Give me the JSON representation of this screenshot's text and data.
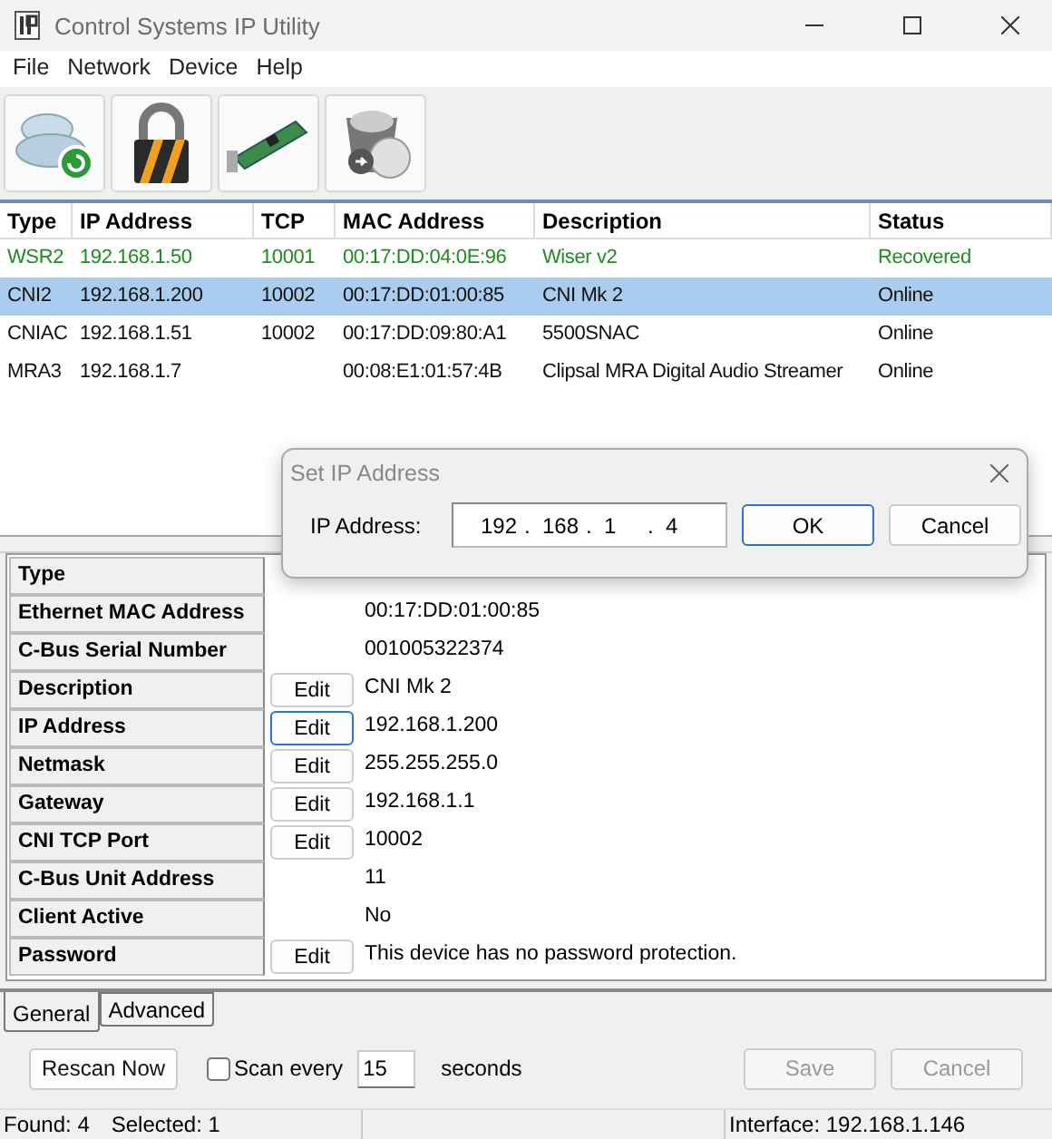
{
  "window": {
    "title": "Control Systems IP Utility"
  },
  "menu": [
    "File",
    "Network",
    "Device",
    "Help"
  ],
  "table": {
    "columns": [
      "Type",
      "IP Address",
      "TCP",
      "MAC Address",
      "Description",
      "Status"
    ],
    "rows": [
      {
        "cells": [
          "WSR2",
          "192.168.1.50",
          "10001",
          "00:17:DD:04:0E:96",
          "Wiser v2",
          "Recovered"
        ],
        "color": "#1e8c1e",
        "selected": false
      },
      {
        "cells": [
          "CNI2",
          "192.168.1.200",
          "10002",
          "00:17:DD:01:00:85",
          "CNI Mk 2",
          "Online"
        ],
        "selected": true
      },
      {
        "cells": [
          "CNIAC",
          "192.168.1.51",
          "10002",
          "00:17:DD:09:80:A1",
          "5500SNAC",
          "Online"
        ],
        "selected": false
      },
      {
        "cells": [
          "MRA3",
          "192.168.1.7",
          "",
          "00:08:E1:01:57:4B",
          "Clipsal MRA Digital Audio Streamer",
          "Online"
        ],
        "selected": false
      }
    ]
  },
  "properties": [
    {
      "label": "Type"
    },
    {
      "label": "Ethernet MAC Address",
      "value": "00:17:DD:01:00:85"
    },
    {
      "label": "C-Bus Serial Number",
      "value": "001005322374"
    },
    {
      "label": "Description",
      "value": "CNI Mk 2",
      "edit": {
        "label": "Edit",
        "focused": false
      }
    },
    {
      "label": "IP Address",
      "value": "192.168.1.200",
      "edit": {
        "label": "Edit",
        "focused": true
      }
    },
    {
      "label": "Netmask",
      "value": "255.255.255.0",
      "edit": {
        "label": "Edit",
        "focused": false
      }
    },
    {
      "label": "Gateway",
      "value": "192.168.1.1",
      "edit": {
        "label": "Edit",
        "focused": false
      }
    },
    {
      "label": "CNI TCP Port",
      "value": "10002",
      "edit": {
        "label": "Edit",
        "focused": false
      }
    },
    {
      "label": "C-Bus Unit Address",
      "value": "11"
    },
    {
      "label": "Client Active",
      "value": "No"
    },
    {
      "label": "Password",
      "value": "This device has no password protection.",
      "edit": {
        "label": "Edit",
        "focused": false
      }
    }
  ],
  "tabs": [
    {
      "label": "General",
      "selected": true
    },
    {
      "label": "Advanced",
      "selected": false
    }
  ],
  "controls": {
    "rescan": "Rescan Now",
    "scan_label": "Scan every",
    "scan_checked": false,
    "interval": "15",
    "unit": "seconds",
    "save": {
      "label": "Save",
      "disabled": true
    },
    "cancel": {
      "label": "Cancel",
      "disabled": true
    }
  },
  "status_bar": {
    "found": "Found: 4",
    "selected": "Selected: 1",
    "interface": "Interface: 192.168.1.146"
  },
  "dialog": {
    "title": "Set IP Address",
    "label": "IP Address:",
    "octets": [
      "192",
      "168",
      "1",
      "4"
    ],
    "separator": ".",
    "ok": "OK",
    "cancel": "Cancel"
  }
}
